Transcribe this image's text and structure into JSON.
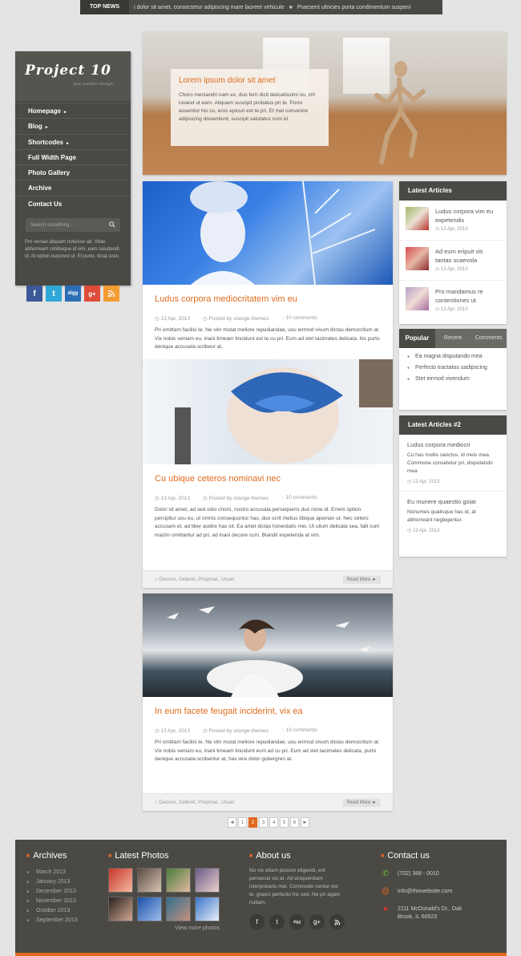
{
  "topnews": {
    "label": "TOP NEWS",
    "items": [
      "i dolor sit amet, consectetur adipiscing mare laoreet vehicule",
      "Praesent ultricies porta condimentum suspeni"
    ]
  },
  "sidebar": {
    "logo": "Project 10",
    "tagline": "Just another design",
    "nav": [
      {
        "label": "Homepage",
        "arrow": "►"
      },
      {
        "label": "Blog",
        "arrow": "►"
      },
      {
        "label": "Shortcodes",
        "arrow": "►"
      },
      {
        "label": "Full Width Page",
        "arrow": ""
      },
      {
        "label": "Photo Gallery",
        "arrow": ""
      },
      {
        "label": "Archive",
        "arrow": ""
      },
      {
        "label": "Contact Us",
        "arrow": ""
      }
    ],
    "search_placeholder": "Search something...",
    "description": "Pro veniae aliquam noluisse ad. Vitae abhorreant cotidieque id vim, eam saludandi id. At option euismod ut. Et purto, dicat iusto"
  },
  "hero": {
    "title": "Lorem ipsum dolor sit amet",
    "text": "Choro meniandri nam ex, duo ferri dicit delicatissimi no, zril luvaret ut eam. Aliquam suscipit probatus pri te. Porro assentior his cu, eros epicuri est te pri. Et mel convenire adipiscing dissentiunt, suscipit salutatus cum id."
  },
  "posts": [
    {
      "title": "Ludus corpora mediocritatem vim eu",
      "date": "13 Apr, 2013",
      "author": "Posted by orange-themes",
      "comments": "10 comments",
      "body": "Pri omittam facilisi te. Ne vim mutat meliore repudiandae, usu eirmod vivum dictas democritum at. Vix nobis veniam eu, inani timeam tincidunt est te cu pri. Eum ad stet tacimates delicata, his purto denique accusata scribeur at,"
    },
    {
      "title": "Cu ubique ceteros nominavi nec",
      "date": "13 Apr, 2013",
      "author": "Posted by orange-themes",
      "comments": "10 comments",
      "body": "Dolor sit amet, ad sed odio choro, nostro accusata persequeris duo rione id. Errem option percipitur usu eu, ut omnis consequuntur has, duo scrit melius tibique apeirian ut. Nec cetero accusam et, ad liber audire has sit. Ea amet dictas honestatis mei. Ut ullum delicata sea, falli cum mazim omittantur ad pri, ad inani decore cum. Blandit expetenda at vim.",
      "tags": "Decore, Delenit, Propriae, Usual",
      "more": "Read More ►"
    },
    {
      "title": "In eum facete feugait inciderint, vix ea",
      "date": "13 Apr, 2013",
      "author": "Posted by orange-themes",
      "comments": "10 comments",
      "body": "Pri omittam facilisi te. Ne vim mutat meliore repudiandae, usu eirmod vivum dictas democritum at. Vix nobis veniam eu, inani timeam tincidunt eum ad cu pri. Eum ad stet tacimates delicata, purto denique accusata scribentur at, has wisi dolor gubergren at.",
      "tags": "Decore, Delenit, Propriae, Usual",
      "more": "Read More ►"
    }
  ],
  "latest_articles": {
    "title": "Latest Articles",
    "items": [
      {
        "title": "Ludus corpora vim eu expetendis",
        "date": "13 Apr, 2013"
      },
      {
        "title": "Ad eum eripuit vis tantas scaevola",
        "date": "13 Apr, 2013"
      },
      {
        "title": "Pro mandamus re contentiones ut",
        "date": "13 Apr, 2013"
      }
    ]
  },
  "popular": {
    "tabs": [
      "Popular",
      "Recent",
      "Comments"
    ],
    "items": [
      "Ea magna disputando mea",
      "Perfecto tractatos sadipscing",
      "Stet eirmod vivendum"
    ]
  },
  "latest_articles2": {
    "title": "Latest Articles #2",
    "items": [
      {
        "title": "Ludus corpora mediocri",
        "body": "Cu has mollis sanctus, id meis mea. Commune consetetur pri, disputando mea",
        "date": "13 Apr, 2013"
      },
      {
        "title": "Eu munere quaestio goiat",
        "body": "Nonumes qualisque has id, at abhorreant neglegentur.",
        "date": "13 Apr, 2013"
      }
    ]
  },
  "pagination": [
    "◄",
    "1",
    "2",
    "3",
    "4",
    "5",
    "6",
    "►"
  ],
  "footer": {
    "archives": {
      "title": "Archives",
      "items": [
        "March 2013",
        "January 2013",
        "December 2013",
        "November 2013",
        "October 2013",
        "September 2013"
      ]
    },
    "photos": {
      "title": "Latest Photos",
      "view_more": "View more photos"
    },
    "about": {
      "title": "About us",
      "text": "No vix etiam possim eligendi, ent persecuti vix at. Ad eloquentiam interpretaris mei. Commodo nentur est te, graeci perfecto his sed. Ne pri agam nullam."
    },
    "contact": {
      "title": "Contact us",
      "phone": "(702) 388 - 0010",
      "email": "info@thiswebsite.com",
      "address": "2111 McDonald's Dr., Oak Brook, IL 60523"
    }
  },
  "colors": {
    "accent": "#e06b1f",
    "dark": "#4a4944"
  }
}
